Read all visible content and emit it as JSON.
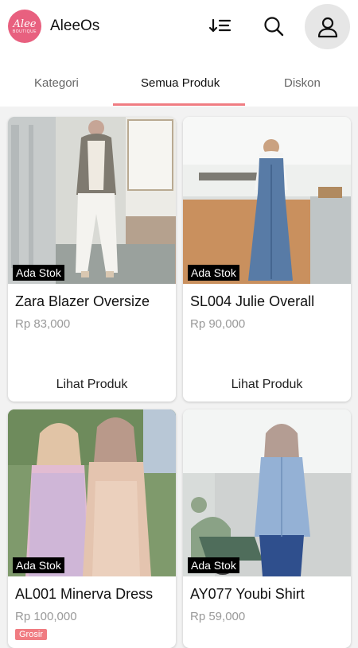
{
  "header": {
    "logo_text": "Alee",
    "logo_sub": "BOUTIQUE",
    "title": "AleeOs",
    "icons": {
      "sort": "sort-icon",
      "search": "search-icon",
      "profile": "person-icon"
    }
  },
  "tabs": [
    {
      "label": "Kategori",
      "active": false
    },
    {
      "label": "Semua Produk",
      "active": true
    },
    {
      "label": "Diskon",
      "active": false
    }
  ],
  "products": [
    {
      "name": "Zara Blazer Oversize",
      "price": "Rp 83,000",
      "stock": "Ada Stok",
      "button": "Lihat Produk"
    },
    {
      "name": "SL004 Julie Overall",
      "price": "Rp 90,000",
      "stock": "Ada Stok",
      "button": "Lihat Produk"
    },
    {
      "name": "AL001 Minerva Dress",
      "price": "Rp 100,000",
      "stock": "Ada Stok",
      "badge": "Grosir"
    },
    {
      "name": "AY077 Youbi Shirt",
      "price": "Rp 59,000",
      "stock": "Ada Stok"
    }
  ],
  "colors": {
    "accent": "#f07c82",
    "logo": "#e8607f",
    "background": "#f2f2f2"
  }
}
